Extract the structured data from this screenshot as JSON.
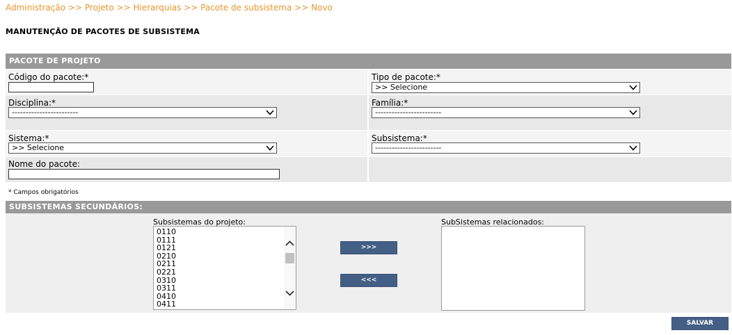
{
  "breadcrumb": {
    "items": [
      "Administração",
      "Projeto",
      "Hierarquias",
      "Pacote de subsistema",
      "Novo"
    ],
    "separator": ">>"
  },
  "page_title": "MANUTENÇÃO DE PACOTES DE SUBSISTEMA",
  "section_projeto": {
    "title": "PACOTE DE PROJETO",
    "codigo": {
      "label": "Código do pacote:*",
      "value": ""
    },
    "tipo": {
      "label": "Tipo de pacote:*",
      "value": ">> Selecione"
    },
    "disciplina": {
      "label": "Disciplina:*",
      "value": "------------------------"
    },
    "familia": {
      "label": "Família:*",
      "value": "------------------------"
    },
    "sistema": {
      "label": "Sistema:*",
      "value": ">> Selecione"
    },
    "subsistema": {
      "label": "Subsistema:*",
      "value": "------------------------"
    },
    "nome": {
      "label": "Nome do pacote:",
      "value": ""
    }
  },
  "required_note": "* Campos obrigatórios",
  "section_secundarios": {
    "title": "SUBSISTEMAS SECUNDÁRIOS:",
    "available_label": "Subsistemas do projeto:",
    "available_items": [
      "0110",
      "0111",
      "0121",
      "0210",
      "0211",
      "0221",
      "0310",
      "0311",
      "0410",
      "0411"
    ],
    "related_label": "SubSistemas relacionados:",
    "related_items": [],
    "add_button": ">>>",
    "remove_button": "<<<"
  },
  "save_button": "SALVAR",
  "colors": {
    "breadcrumb": "#e8952e",
    "section_header_bg": "#999999",
    "button_bg": "#445f86"
  }
}
